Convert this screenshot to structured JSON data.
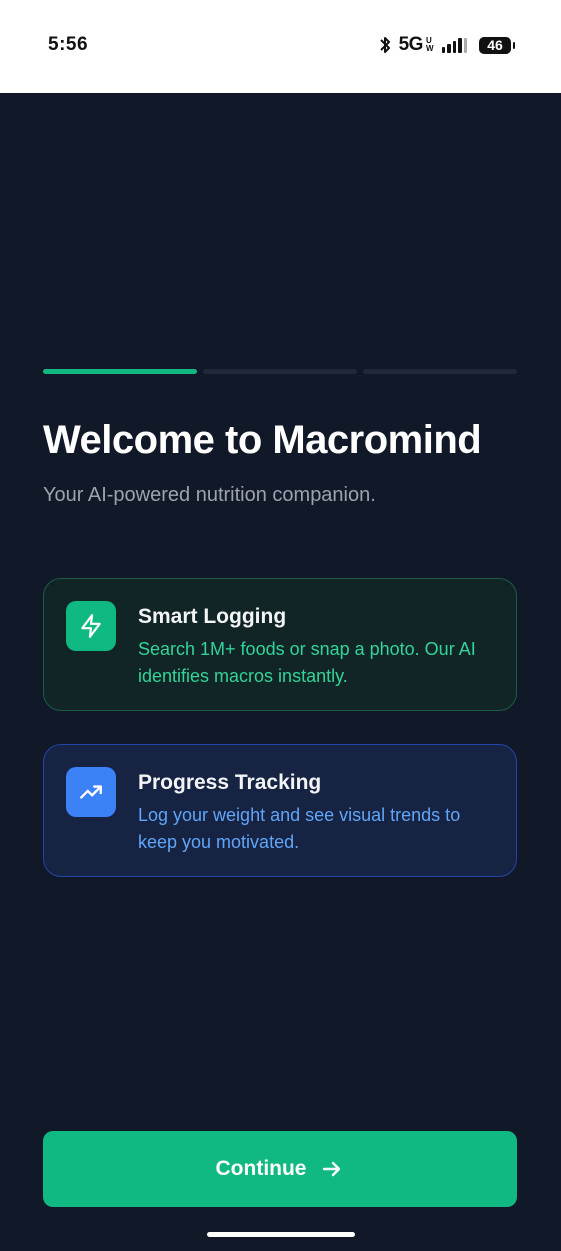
{
  "status_bar": {
    "time": "5:56",
    "network": "5G",
    "network_sub_top": "U",
    "network_sub_bottom": "W",
    "battery": "46",
    "icons": [
      "bluetooth-icon",
      "signal-icon",
      "battery-icon"
    ]
  },
  "onboarding": {
    "step_current": 1,
    "step_total": 3,
    "title": "Welcome to Macromind",
    "subtitle": "Your AI-powered nutrition companion."
  },
  "features": [
    {
      "title": "Smart Logging",
      "description": "Search 1M+ foods or snap a photo. Our AI identifies macros instantly.",
      "icon": "lightning-icon",
      "accent": "#10b981"
    },
    {
      "title": "Progress Tracking",
      "description": "Log your weight and see visual trends to keep you motivated.",
      "icon": "trending-up-icon",
      "accent": "#3b82f6"
    }
  ],
  "actions": {
    "continue_label": "Continue",
    "continue_icon": "arrow-right-icon"
  },
  "colors": {
    "background": "#111827",
    "primary": "#10b981",
    "secondary": "#3b82f6"
  }
}
